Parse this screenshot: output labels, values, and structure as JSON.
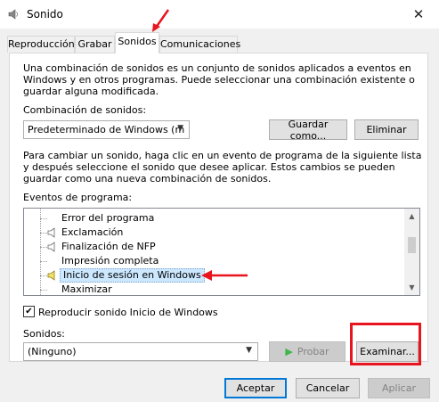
{
  "window": {
    "title": "Sonido",
    "close_glyph": "✕"
  },
  "tabs": [
    {
      "label": "Reproducción",
      "active": false
    },
    {
      "label": "Grabar",
      "active": false
    },
    {
      "label": "Sonidos",
      "active": true
    },
    {
      "label": "Comunicaciones",
      "active": false
    }
  ],
  "intro": {
    "line1": "Una combinación de sonidos es un conjunto de sonidos aplicados a eventos en",
    "line2": "Windows y en otros programas. Puede seleccionar una combinación existente o",
    "line3": "guardar alguna modificada."
  },
  "scheme": {
    "label": "Combinación de sonidos:",
    "value": "Predeterminado de Windows (m",
    "save_as": "Guardar como...",
    "delete": "Eliminar"
  },
  "instructions": {
    "line1": "Para cambiar un sonido, haga clic en un evento de programa de la siguiente lista",
    "line2": "y después seleccione el sonido que desee aplicar. Estos cambios se pueden",
    "line3": "guardar como una nueva combinación de sonidos."
  },
  "events": {
    "label": "Eventos de programa:",
    "items": [
      {
        "label": "Error del programa",
        "has_sound": false,
        "selected": false
      },
      {
        "label": "Exclamación",
        "has_sound": true,
        "selected": false
      },
      {
        "label": "Finalización de NFP",
        "has_sound": true,
        "selected": false
      },
      {
        "label": "Impresión completa",
        "has_sound": false,
        "selected": false
      },
      {
        "label": "Inicio de sesión en Windows",
        "has_sound": true,
        "selected": true
      },
      {
        "label": "Maximizar",
        "has_sound": false,
        "selected": false
      }
    ]
  },
  "startup_sound": {
    "label": "Reproducir sonido Inicio de Windows",
    "checked": true
  },
  "sounds": {
    "label": "Sonidos:",
    "value": "(Ninguno)",
    "test": "Probar",
    "browse": "Examinar..."
  },
  "footer": {
    "ok": "Aceptar",
    "cancel": "Cancelar",
    "apply": "Aplicar"
  },
  "colors": {
    "annotation_red": "#e8141e",
    "selection": "#cce8ff",
    "accent": "#0078d7"
  }
}
